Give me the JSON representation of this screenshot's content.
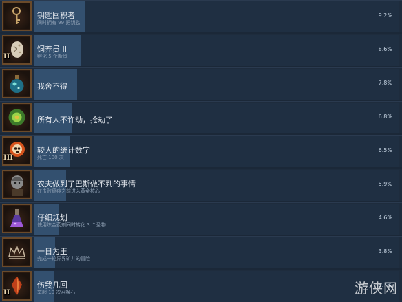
{
  "achievements": [
    {
      "title": "钥匙囤积者",
      "desc": "同时拥有 99 把钥匙",
      "pct": "9.2%",
      "pct_value": 9.2,
      "icon": "key-icon",
      "roman": ""
    },
    {
      "title": "饲养员 II",
      "desc": "孵化 5 个新蛋",
      "pct": "8.6%",
      "pct_value": 8.6,
      "icon": "egg-icon",
      "roman": "II"
    },
    {
      "title": "我舍不得",
      "desc": "",
      "pct": "7.8%",
      "pct_value": 7.8,
      "icon": "potion-icon",
      "roman": ""
    },
    {
      "title": "所有人不许动，抢劫了",
      "desc": "",
      "pct": "6.8%",
      "pct_value": 6.8,
      "icon": "orb-icon",
      "roman": ""
    },
    {
      "title": "较大的统计数字",
      "desc": "死亡 100 次",
      "pct": "6.5%",
      "pct_value": 6.5,
      "icon": "skull-icon",
      "roman": "III"
    },
    {
      "title": "农夫做到了巴斯做不到的事情",
      "desc": "在击败瘟疫之前进入黄金核心",
      "pct": "5.9%",
      "pct_value": 5.9,
      "icon": "farmer-icon",
      "roman": ""
    },
    {
      "title": "仔细规划",
      "desc": "使用炼金药剂同时转化 3 个圣物",
      "pct": "4.6%",
      "pct_value": 4.6,
      "icon": "flask-icon",
      "roman": ""
    },
    {
      "title": "一日为王",
      "desc": "完成一轮异界矿井的冒险",
      "pct": "3.8%",
      "pct_value": 3.8,
      "icon": "crown-icon",
      "roman": ""
    },
    {
      "title": "伤我几回",
      "desc": "举起 10 次召唤石",
      "pct": "3.7%",
      "pct_value": 3.7,
      "icon": "crystal-icon",
      "roman": "II"
    }
  ],
  "watermark": "游侠网",
  "colors": {
    "bar": "#33506f",
    "background": "#1b2838"
  }
}
